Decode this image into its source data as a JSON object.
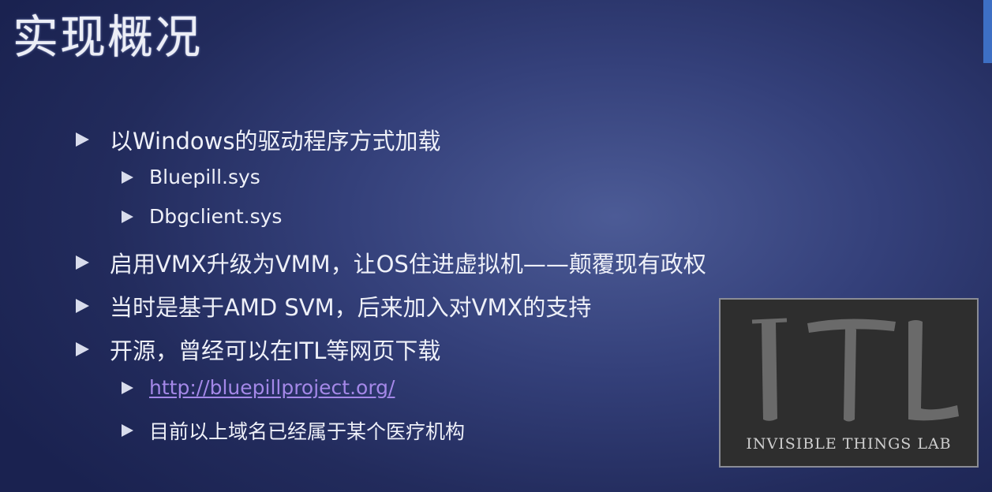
{
  "slide": {
    "title": "实现概况",
    "bullets": [
      {
        "level": 1,
        "text": "以Windows的驱动程序方式加载"
      },
      {
        "level": 2,
        "text": "Bluepill.sys"
      },
      {
        "level": 2,
        "text": "Dbgclient.sys"
      },
      {
        "level": 1,
        "text": "启用VMX升级为VMM，让OS住进虚拟机——颠覆现有政权"
      },
      {
        "level": 1,
        "text": "当时是基于AMD SVM，后来加入对VMX的支持"
      },
      {
        "level": 1,
        "text": "开源，曾经可以在ITL等网页下载"
      },
      {
        "level": 2,
        "text": "http://bluepillproject.org/",
        "link": true
      },
      {
        "level": 2,
        "text": "目前以上域名已经属于某个医疗机构"
      }
    ]
  },
  "logo": {
    "mark": "ITL",
    "caption": "INVISIBLE THINGS LAB"
  },
  "colors": {
    "background": "#2a3468",
    "link": "#a488e8",
    "accent_tab": "#3d6fc4"
  },
  "icons": {
    "bullet": "triangle-right-icon"
  }
}
